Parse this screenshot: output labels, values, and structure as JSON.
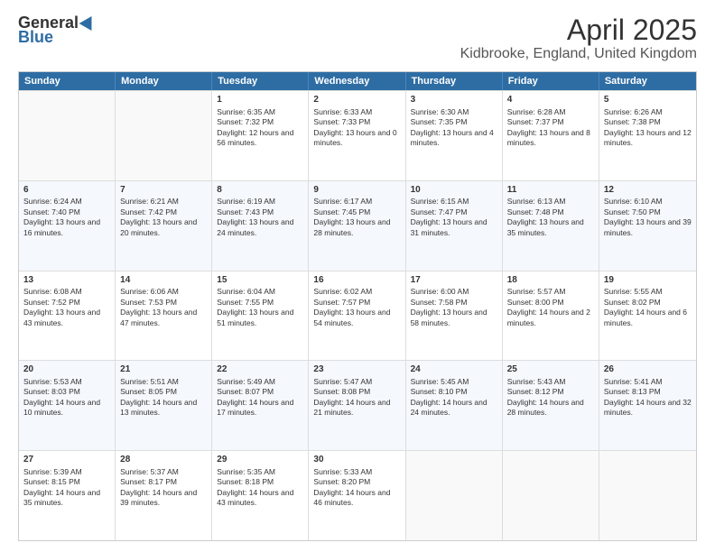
{
  "logo": {
    "general": "General",
    "blue": "Blue"
  },
  "title": "April 2025",
  "subtitle": "Kidbrooke, England, United Kingdom",
  "days": [
    "Sunday",
    "Monday",
    "Tuesday",
    "Wednesday",
    "Thursday",
    "Friday",
    "Saturday"
  ],
  "weeks": [
    [
      {
        "day": "",
        "sunrise": "",
        "sunset": "",
        "daylight": ""
      },
      {
        "day": "",
        "sunrise": "",
        "sunset": "",
        "daylight": ""
      },
      {
        "day": "1",
        "sunrise": "Sunrise: 6:35 AM",
        "sunset": "Sunset: 7:32 PM",
        "daylight": "Daylight: 12 hours and 56 minutes."
      },
      {
        "day": "2",
        "sunrise": "Sunrise: 6:33 AM",
        "sunset": "Sunset: 7:33 PM",
        "daylight": "Daylight: 13 hours and 0 minutes."
      },
      {
        "day": "3",
        "sunrise": "Sunrise: 6:30 AM",
        "sunset": "Sunset: 7:35 PM",
        "daylight": "Daylight: 13 hours and 4 minutes."
      },
      {
        "day": "4",
        "sunrise": "Sunrise: 6:28 AM",
        "sunset": "Sunset: 7:37 PM",
        "daylight": "Daylight: 13 hours and 8 minutes."
      },
      {
        "day": "5",
        "sunrise": "Sunrise: 6:26 AM",
        "sunset": "Sunset: 7:38 PM",
        "daylight": "Daylight: 13 hours and 12 minutes."
      }
    ],
    [
      {
        "day": "6",
        "sunrise": "Sunrise: 6:24 AM",
        "sunset": "Sunset: 7:40 PM",
        "daylight": "Daylight: 13 hours and 16 minutes."
      },
      {
        "day": "7",
        "sunrise": "Sunrise: 6:21 AM",
        "sunset": "Sunset: 7:42 PM",
        "daylight": "Daylight: 13 hours and 20 minutes."
      },
      {
        "day": "8",
        "sunrise": "Sunrise: 6:19 AM",
        "sunset": "Sunset: 7:43 PM",
        "daylight": "Daylight: 13 hours and 24 minutes."
      },
      {
        "day": "9",
        "sunrise": "Sunrise: 6:17 AM",
        "sunset": "Sunset: 7:45 PM",
        "daylight": "Daylight: 13 hours and 28 minutes."
      },
      {
        "day": "10",
        "sunrise": "Sunrise: 6:15 AM",
        "sunset": "Sunset: 7:47 PM",
        "daylight": "Daylight: 13 hours and 31 minutes."
      },
      {
        "day": "11",
        "sunrise": "Sunrise: 6:13 AM",
        "sunset": "Sunset: 7:48 PM",
        "daylight": "Daylight: 13 hours and 35 minutes."
      },
      {
        "day": "12",
        "sunrise": "Sunrise: 6:10 AM",
        "sunset": "Sunset: 7:50 PM",
        "daylight": "Daylight: 13 hours and 39 minutes."
      }
    ],
    [
      {
        "day": "13",
        "sunrise": "Sunrise: 6:08 AM",
        "sunset": "Sunset: 7:52 PM",
        "daylight": "Daylight: 13 hours and 43 minutes."
      },
      {
        "day": "14",
        "sunrise": "Sunrise: 6:06 AM",
        "sunset": "Sunset: 7:53 PM",
        "daylight": "Daylight: 13 hours and 47 minutes."
      },
      {
        "day": "15",
        "sunrise": "Sunrise: 6:04 AM",
        "sunset": "Sunset: 7:55 PM",
        "daylight": "Daylight: 13 hours and 51 minutes."
      },
      {
        "day": "16",
        "sunrise": "Sunrise: 6:02 AM",
        "sunset": "Sunset: 7:57 PM",
        "daylight": "Daylight: 13 hours and 54 minutes."
      },
      {
        "day": "17",
        "sunrise": "Sunrise: 6:00 AM",
        "sunset": "Sunset: 7:58 PM",
        "daylight": "Daylight: 13 hours and 58 minutes."
      },
      {
        "day": "18",
        "sunrise": "Sunrise: 5:57 AM",
        "sunset": "Sunset: 8:00 PM",
        "daylight": "Daylight: 14 hours and 2 minutes."
      },
      {
        "day": "19",
        "sunrise": "Sunrise: 5:55 AM",
        "sunset": "Sunset: 8:02 PM",
        "daylight": "Daylight: 14 hours and 6 minutes."
      }
    ],
    [
      {
        "day": "20",
        "sunrise": "Sunrise: 5:53 AM",
        "sunset": "Sunset: 8:03 PM",
        "daylight": "Daylight: 14 hours and 10 minutes."
      },
      {
        "day": "21",
        "sunrise": "Sunrise: 5:51 AM",
        "sunset": "Sunset: 8:05 PM",
        "daylight": "Daylight: 14 hours and 13 minutes."
      },
      {
        "day": "22",
        "sunrise": "Sunrise: 5:49 AM",
        "sunset": "Sunset: 8:07 PM",
        "daylight": "Daylight: 14 hours and 17 minutes."
      },
      {
        "day": "23",
        "sunrise": "Sunrise: 5:47 AM",
        "sunset": "Sunset: 8:08 PM",
        "daylight": "Daylight: 14 hours and 21 minutes."
      },
      {
        "day": "24",
        "sunrise": "Sunrise: 5:45 AM",
        "sunset": "Sunset: 8:10 PM",
        "daylight": "Daylight: 14 hours and 24 minutes."
      },
      {
        "day": "25",
        "sunrise": "Sunrise: 5:43 AM",
        "sunset": "Sunset: 8:12 PM",
        "daylight": "Daylight: 14 hours and 28 minutes."
      },
      {
        "day": "26",
        "sunrise": "Sunrise: 5:41 AM",
        "sunset": "Sunset: 8:13 PM",
        "daylight": "Daylight: 14 hours and 32 minutes."
      }
    ],
    [
      {
        "day": "27",
        "sunrise": "Sunrise: 5:39 AM",
        "sunset": "Sunset: 8:15 PM",
        "daylight": "Daylight: 14 hours and 35 minutes."
      },
      {
        "day": "28",
        "sunrise": "Sunrise: 5:37 AM",
        "sunset": "Sunset: 8:17 PM",
        "daylight": "Daylight: 14 hours and 39 minutes."
      },
      {
        "day": "29",
        "sunrise": "Sunrise: 5:35 AM",
        "sunset": "Sunset: 8:18 PM",
        "daylight": "Daylight: 14 hours and 43 minutes."
      },
      {
        "day": "30",
        "sunrise": "Sunrise: 5:33 AM",
        "sunset": "Sunset: 8:20 PM",
        "daylight": "Daylight: 14 hours and 46 minutes."
      },
      {
        "day": "",
        "sunrise": "",
        "sunset": "",
        "daylight": ""
      },
      {
        "day": "",
        "sunrise": "",
        "sunset": "",
        "daylight": ""
      },
      {
        "day": "",
        "sunrise": "",
        "sunset": "",
        "daylight": ""
      }
    ]
  ]
}
